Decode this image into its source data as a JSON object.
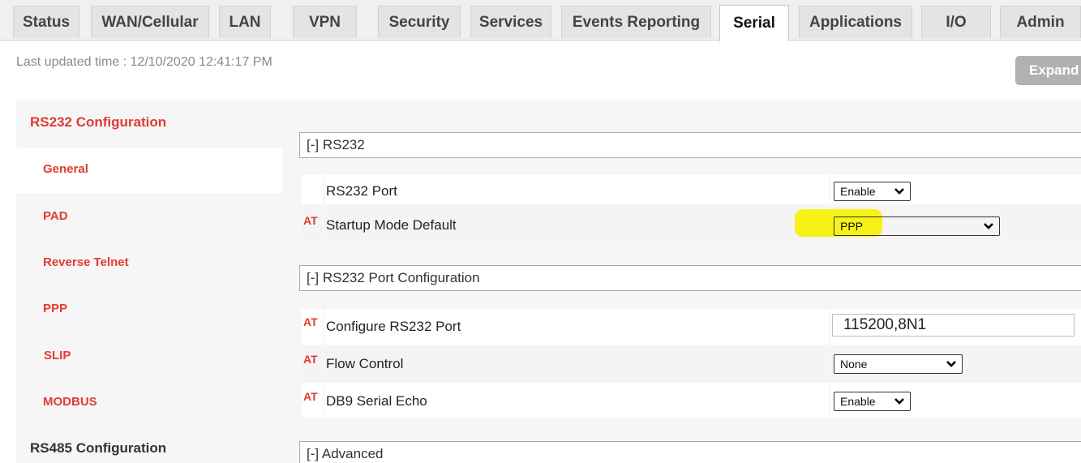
{
  "tabs": [
    {
      "label": "Status"
    },
    {
      "label": "WAN/Cellular"
    },
    {
      "label": "LAN"
    },
    {
      "label": "VPN"
    },
    {
      "label": "Security"
    },
    {
      "label": "Services"
    },
    {
      "label": "Events Reporting"
    },
    {
      "label": "Serial",
      "active": true
    },
    {
      "label": "Applications"
    },
    {
      "label": "I/O"
    },
    {
      "label": "Admin"
    }
  ],
  "status": {
    "last_updated": "Last updated time : 12/10/2020 12:41:17 PM"
  },
  "expand_label": "Expand",
  "sidebar": {
    "rs232_header": "RS232 Configuration",
    "items": [
      {
        "label": "General",
        "active": true
      },
      {
        "label": "PAD"
      },
      {
        "label": "Reverse Telnet"
      },
      {
        "label": "PPP"
      },
      {
        "label": "SLIP"
      },
      {
        "label": "MODBUS"
      }
    ],
    "rs485_header": "RS485 Configuration"
  },
  "sections": {
    "rs232": "[-] RS232",
    "port_config": "[-] RS232 Port Configuration",
    "advanced": "[-] Advanced"
  },
  "at_marker": "AT",
  "fields": {
    "rs232_port": {
      "label": "RS232 Port",
      "value": "Enable"
    },
    "startup_mode": {
      "label": "Startup Mode Default",
      "value": "PPP"
    },
    "configure_port": {
      "label": "Configure RS232 Port",
      "value": "115200,8N1"
    },
    "flow_control": {
      "label": "Flow Control",
      "value": "None"
    },
    "db9_echo": {
      "label": "DB9 Serial Echo",
      "value": "Enable"
    }
  },
  "colors": {
    "accent_red": "#e23b33",
    "highlight_yellow": "#f6f200",
    "tab_bg": "#e4e4e4"
  }
}
